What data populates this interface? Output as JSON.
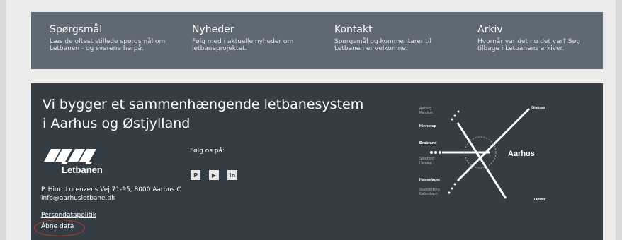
{
  "nav": [
    {
      "title": "Spørgsmål",
      "desc": "Læs de oftest stillede spørgsmål om Letbanen - og svarene herpå."
    },
    {
      "title": "Nyheder",
      "desc": "Følg med i aktuelle nyheder om letbaneprojektet."
    },
    {
      "title": "Kontakt",
      "desc": "Spørgsmål og kommentarer til Letbanen er velkomne."
    },
    {
      "title": "Arkiv",
      "desc": "Hvornår var det nu det var? Søg tilbage i Letbanens arkiver."
    }
  ],
  "footer": {
    "headline_line1": "Vi bygger et sammenhængende letbanesystem",
    "headline_line2": "i Aarhus og Østjylland",
    "logo_text": "Letbanen",
    "address": "P. Hiort Lorenzens Vej 71-95, 8000 Aarhus C",
    "email": "info@aarhusletbane.dk",
    "links": {
      "privacy": "Persondatapolitik",
      "open_data": "Åbne data"
    },
    "follow_label": "Følg os på:",
    "social": [
      {
        "icon": "pinterest-icon",
        "glyph": "P"
      },
      {
        "icon": "youtube-icon",
        "glyph": "▶"
      },
      {
        "icon": "linkedin-icon",
        "glyph": "in"
      }
    ]
  },
  "map": {
    "center": "Aarhus",
    "stations": {
      "aalborg": "Aalborg",
      "randers": "Randers",
      "hinnerup": "Hinnerup",
      "brabrand": "Brabrand",
      "silkeborg": "Silkeborg",
      "herning": "Herning",
      "hasselager": "Hasselager",
      "skanderborg": "Skanderborg",
      "kobenhavn": "København",
      "grenaa": "Grenaa",
      "odder": "Odder"
    }
  },
  "colors": {
    "top_bar": "#5f6973",
    "footer_bg": "#343c44",
    "highlight": "#c0392b"
  }
}
